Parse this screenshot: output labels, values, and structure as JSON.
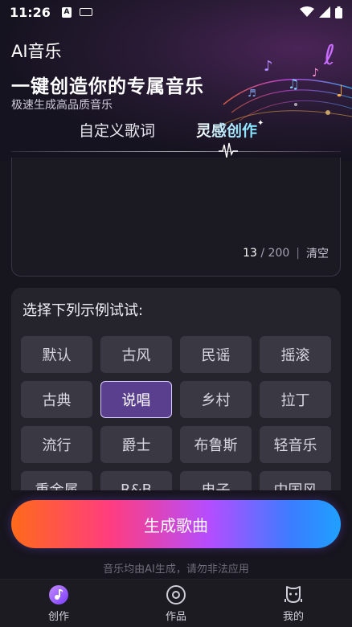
{
  "status_bar": {
    "time": "11:26",
    "a_icon_label": "A"
  },
  "header": {
    "app_title": "AI音乐",
    "hero_title": "一键创造你的专属音乐",
    "hero_subtitle": "极速生成高品质音乐"
  },
  "tabs": [
    {
      "label": "自定义歌词",
      "active": false
    },
    {
      "label": "灵感创作",
      "active": true
    }
  ],
  "lyric_box": {
    "char_count": "13",
    "char_limit": "200",
    "counter_separator": "/",
    "clear_label": "清空"
  },
  "styles": {
    "title": "选择下列示例试试:",
    "selected": "说唱",
    "chips": [
      "默认",
      "古风",
      "民谣",
      "摇滚",
      "古典",
      "说唱",
      "乡村",
      "拉丁",
      "流行",
      "爵士",
      "布鲁斯",
      "轻音乐",
      "重金属",
      "R&B",
      "电子",
      "中国风"
    ]
  },
  "generate_button": {
    "label": "生成歌曲"
  },
  "disclaimer": "音乐均由AI生成，请勿非法应用",
  "bottom_nav": [
    {
      "label": "创作",
      "icon": "music-disc-icon",
      "active": true
    },
    {
      "label": "作品",
      "icon": "record-icon",
      "active": false
    },
    {
      "label": "我的",
      "icon": "robot-face-icon",
      "active": false
    }
  ],
  "colors": {
    "accent_purple": "#5b3f8f",
    "button_gradient": [
      "#ff6a1a",
      "#ff3d7f",
      "#b54dff",
      "#3b7dff",
      "#1fa0ff"
    ]
  }
}
